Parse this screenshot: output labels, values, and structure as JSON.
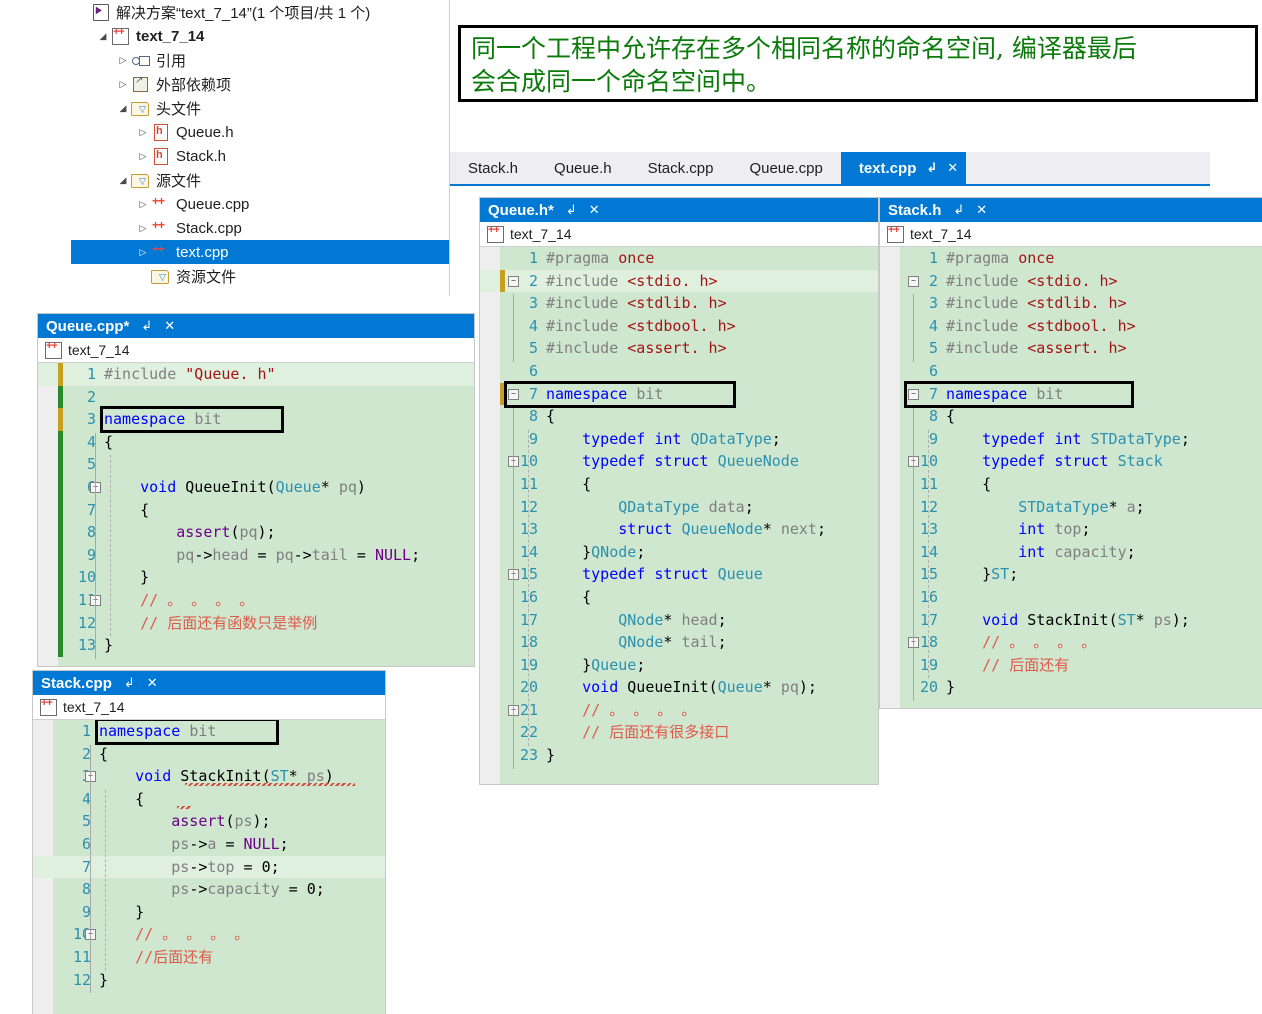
{
  "solution_explorer": {
    "name": "solution-explorer",
    "tree": [
      {
        "label": "解决方案“text_7_14”(1 个项目/共 1 个)",
        "icon": "solution-icon",
        "indent": 0,
        "twisty": "",
        "bold": false,
        "selected": false,
        "type": "solution"
      },
      {
        "label": "text_7_14",
        "icon": "project-icon",
        "indent": 1,
        "twisty": "◢",
        "bold": true,
        "selected": false,
        "type": "project"
      },
      {
        "label": "引用",
        "icon": "references-icon",
        "indent": 2,
        "twisty": "▷",
        "bold": false,
        "selected": false,
        "type": "references"
      },
      {
        "label": "外部依赖项",
        "icon": "external-dependencies-icon",
        "indent": 2,
        "twisty": "▷",
        "bold": false,
        "selected": false,
        "type": "external"
      },
      {
        "label": "头文件",
        "icon": "filter-folder-icon",
        "indent": 2,
        "twisty": "◢",
        "bold": false,
        "selected": false,
        "type": "folder"
      },
      {
        "label": "Queue.h",
        "icon": "header-file-icon",
        "indent": 3,
        "twisty": "▷",
        "bold": false,
        "selected": false,
        "type": "header"
      },
      {
        "label": "Stack.h",
        "icon": "header-file-icon",
        "indent": 3,
        "twisty": "▷",
        "bold": false,
        "selected": false,
        "type": "header"
      },
      {
        "label": "源文件",
        "icon": "filter-folder-icon",
        "indent": 2,
        "twisty": "◢",
        "bold": false,
        "selected": false,
        "type": "folder"
      },
      {
        "label": "Queue.cpp",
        "icon": "cpp-file-icon",
        "indent": 3,
        "twisty": "▷",
        "bold": false,
        "selected": false,
        "type": "cpp"
      },
      {
        "label": "Stack.cpp",
        "icon": "cpp-file-icon",
        "indent": 3,
        "twisty": "▷",
        "bold": false,
        "selected": false,
        "type": "cpp"
      },
      {
        "label": "text.cpp",
        "icon": "cpp-file-icon",
        "indent": 3,
        "twisty": "▷",
        "bold": false,
        "selected": true,
        "type": "cpp"
      },
      {
        "label": "资源文件",
        "icon": "filter-folder-icon",
        "indent": 3,
        "twisty": "",
        "bold": false,
        "selected": false,
        "type": "folder"
      }
    ]
  },
  "note": {
    "line1": "同一个工程中允许存在多个相同名称的命名空间, 编译器最后",
    "line2": "会合成同一个命名空间中。",
    "text_color": "#0a7a0a",
    "border_color": "#000000"
  },
  "tab_strip": {
    "tabs": [
      {
        "label": "Stack.h",
        "active": false
      },
      {
        "label": "Queue.h",
        "active": false
      },
      {
        "label": "Stack.cpp",
        "active": false
      },
      {
        "label": "Queue.cpp",
        "active": false
      },
      {
        "label": "text.cpp",
        "active": true
      }
    ],
    "pin_glyph": "↲",
    "close_glyph": "✕",
    "active_color": "#0078d4"
  },
  "windows": {
    "queue_h": {
      "title": "Queue.h*",
      "pin": "↲",
      "close": "✕",
      "breadcrumb": "text_7_14",
      "lines": [
        {
          "n": "1",
          "text": "#pragma once"
        },
        {
          "n": "2",
          "text": "#include <stdio. h>"
        },
        {
          "n": "3",
          "text": "#include <stdlib. h>"
        },
        {
          "n": "4",
          "text": "#include <stdbool. h>"
        },
        {
          "n": "5",
          "text": "#include <assert. h>"
        },
        {
          "n": "6",
          "text": ""
        },
        {
          "n": "7",
          "text": "namespace bit"
        },
        {
          "n": "8",
          "text": "{"
        },
        {
          "n": "9",
          "text": "    typedef int QDataType;"
        },
        {
          "n": "10",
          "text": "    typedef struct QueueNode"
        },
        {
          "n": "11",
          "text": "    {"
        },
        {
          "n": "12",
          "text": "        QDataType data;"
        },
        {
          "n": "13",
          "text": "        struct QueueNode* next;"
        },
        {
          "n": "14",
          "text": "    }QNode;"
        },
        {
          "n": "15",
          "text": "    typedef struct Queue"
        },
        {
          "n": "16",
          "text": "    {"
        },
        {
          "n": "17",
          "text": "        QNode* head;"
        },
        {
          "n": "18",
          "text": "        QNode* tail;"
        },
        {
          "n": "19",
          "text": "    }Queue;"
        },
        {
          "n": "20",
          "text": "    void QueueInit(Queue* pq);"
        },
        {
          "n": "21",
          "text": "    // 。 。 。 。"
        },
        {
          "n": "22",
          "text": "    // 后面还有很多接口"
        },
        {
          "n": "23",
          "text": "}"
        }
      ]
    },
    "stack_h": {
      "title": "Stack.h",
      "pin": "↲",
      "close": "✕",
      "breadcrumb": "text_7_14",
      "lines": [
        {
          "n": "1",
          "text": "#pragma once"
        },
        {
          "n": "2",
          "text": "#include <stdio. h>"
        },
        {
          "n": "3",
          "text": "#include <stdlib. h>"
        },
        {
          "n": "4",
          "text": "#include <stdbool. h>"
        },
        {
          "n": "5",
          "text": "#include <assert. h>"
        },
        {
          "n": "6",
          "text": ""
        },
        {
          "n": "7",
          "text": "namespace bit"
        },
        {
          "n": "8",
          "text": "{"
        },
        {
          "n": "9",
          "text": "    typedef int STDataType;"
        },
        {
          "n": "10",
          "text": "    typedef struct Stack"
        },
        {
          "n": "11",
          "text": "    {"
        },
        {
          "n": "12",
          "text": "        STDataType* a;"
        },
        {
          "n": "13",
          "text": "        int top;"
        },
        {
          "n": "14",
          "text": "        int capacity;"
        },
        {
          "n": "15",
          "text": "    }ST;"
        },
        {
          "n": "16",
          "text": ""
        },
        {
          "n": "17",
          "text": "    void StackInit(ST* ps);"
        },
        {
          "n": "18",
          "text": "    // 。 。 。 。"
        },
        {
          "n": "19",
          "text": "    // 后面还有"
        },
        {
          "n": "20",
          "text": "}"
        }
      ]
    },
    "queue_cpp": {
      "title": "Queue.cpp*",
      "pin": "↲",
      "close": "✕",
      "breadcrumb": "text_7_14",
      "lines": [
        {
          "n": "1",
          "text": "#include \"Queue. h\""
        },
        {
          "n": "2",
          "text": ""
        },
        {
          "n": "3",
          "text": "namespace bit"
        },
        {
          "n": "4",
          "text": "{"
        },
        {
          "n": "5",
          "text": ""
        },
        {
          "n": "6",
          "text": "    void QueueInit(Queue* pq)"
        },
        {
          "n": "7",
          "text": "    {"
        },
        {
          "n": "8",
          "text": "        assert(pq);"
        },
        {
          "n": "9",
          "text": "        pq->head = pq->tail = NULL;"
        },
        {
          "n": "10",
          "text": "    }"
        },
        {
          "n": "11",
          "text": "    // 。 。 。 。"
        },
        {
          "n": "12",
          "text": "    // 后面还有函数只是举例"
        },
        {
          "n": "13",
          "text": "}"
        }
      ]
    },
    "stack_cpp": {
      "title": "Stack.cpp",
      "pin": "↲",
      "close": "✕",
      "breadcrumb": "text_7_14",
      "lines": [
        {
          "n": "1",
          "text": "namespace bit"
        },
        {
          "n": "2",
          "text": "{"
        },
        {
          "n": "3",
          "text": "    void StackInit(ST* ps)"
        },
        {
          "n": "4",
          "text": "    {"
        },
        {
          "n": "5",
          "text": "        assert(ps);"
        },
        {
          "n": "6",
          "text": "        ps->a = NULL;"
        },
        {
          "n": "7",
          "text": "        ps->top = 0;"
        },
        {
          "n": "8",
          "text": "        ps->capacity = 0;"
        },
        {
          "n": "9",
          "text": "    }"
        },
        {
          "n": "10",
          "text": "    // 。 。 。 。"
        },
        {
          "n": "11",
          "text": "    //后面还有"
        },
        {
          "n": "12",
          "text": "}"
        }
      ]
    }
  },
  "colors": {
    "code_background": "#cfe6cf",
    "current_line": "#dff0df",
    "line_number": "#2b91af",
    "keyword": "#0000ff",
    "type": "#2b91af",
    "string": "#a31515",
    "comment": "#e05a4a",
    "preprocessor": "#808080",
    "macro": "#6f008a",
    "accent": "#0078d4",
    "change_saved": "#2a8a2a",
    "change_unsaved": "#c8a020"
  }
}
